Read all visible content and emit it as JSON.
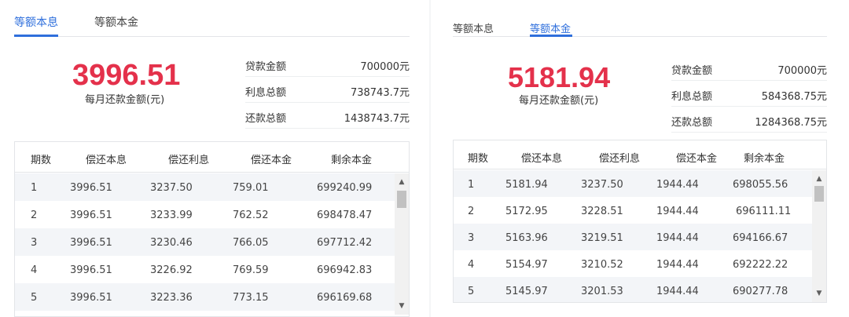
{
  "accent_color": "#2f6fdc",
  "amount_color": "#e4314b",
  "left": {
    "tabs": [
      {
        "label": "等额本息",
        "active": true
      },
      {
        "label": "等额本金",
        "active": false
      }
    ],
    "monthly_amount": "3996.51",
    "monthly_label": "每月还款金额(元)",
    "summary": [
      {
        "label": "贷款金额",
        "value": "700000元"
      },
      {
        "label": "利息总额",
        "value": "738743.7元"
      },
      {
        "label": "还款总额",
        "value": "1438743.7元"
      }
    ],
    "table": {
      "headers": [
        "期数",
        "偿还本息",
        "偿还利息",
        "偿还本金",
        "剩余本金"
      ],
      "rows": [
        [
          "1",
          "3996.51",
          "3237.50",
          "759.01",
          "699240.99"
        ],
        [
          "2",
          "3996.51",
          "3233.99",
          "762.52",
          "698478.47"
        ],
        [
          "3",
          "3996.51",
          "3230.46",
          "766.05",
          "697712.42"
        ],
        [
          "4",
          "3996.51",
          "3226.92",
          "769.59",
          "696942.83"
        ],
        [
          "5",
          "3996.51",
          "3223.36",
          "773.15",
          "696169.68"
        ]
      ]
    }
  },
  "right": {
    "tabs": [
      {
        "label": "等额本息",
        "active": false
      },
      {
        "label": "等额本金",
        "active": true
      }
    ],
    "monthly_amount": "5181.94",
    "monthly_label": "每月还款金额(元)",
    "summary": [
      {
        "label": "贷款金额",
        "value": "700000元"
      },
      {
        "label": "利息总额",
        "value": "584368.75元"
      },
      {
        "label": "还款总额",
        "value": "1284368.75元"
      }
    ],
    "table": {
      "headers": [
        "期数",
        "偿还本息",
        "偿还利息",
        "偿还本金",
        "剩余本金"
      ],
      "rows": [
        [
          "1",
          "5181.94",
          "3237.50",
          "1944.44",
          "698055.56"
        ],
        [
          "2",
          "5172.95",
          "3228.51",
          "1944.44",
          "696111.11"
        ],
        [
          "3",
          "5163.96",
          "3219.51",
          "1944.44",
          "694166.67"
        ],
        [
          "4",
          "5154.97",
          "3210.52",
          "1944.44",
          "692222.22"
        ],
        [
          "5",
          "5145.97",
          "3201.53",
          "1944.44",
          "690277.78"
        ]
      ]
    }
  }
}
